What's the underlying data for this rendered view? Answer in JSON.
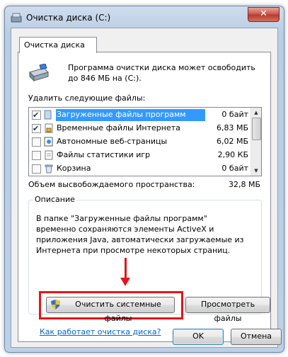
{
  "window": {
    "title": "Очистка диска  (C:)",
    "close_label": "✕"
  },
  "tab": {
    "label": "Очистка диска"
  },
  "intro_text": "Программа очистки диска может освободить до 846 МБ на  (C:).",
  "delete_label": "Удалить следующие файлы:",
  "files": [
    {
      "checked": true,
      "name": "Загруженные файлы программ",
      "size": "0 байт",
      "selected": true,
      "icon": "folder-icon"
    },
    {
      "checked": true,
      "name": "Временные файлы Интернета",
      "size": "6,83 МБ",
      "selected": false,
      "icon": "lock-file-icon"
    },
    {
      "checked": false,
      "name": "Автономные веб-страницы",
      "size": "6,02 МБ",
      "selected": false,
      "icon": "offline-page-icon"
    },
    {
      "checked": false,
      "name": "Файлы статистики игр",
      "size": "2,90 КБ",
      "selected": false,
      "icon": "page-icon"
    },
    {
      "checked": false,
      "name": "Корзина",
      "size": "0 байт",
      "selected": false,
      "icon": "recycle-bin-icon"
    }
  ],
  "total": {
    "label": "Объем высвобождаемого пространства:",
    "value": "32,8 МБ"
  },
  "description": {
    "title": "Описание",
    "text": "В папке \"Загруженные файлы программ\" временно сохраняются элементы ActiveX и приложения Java, автоматически загружаемые из Интернета при просмотре некоторых страниц."
  },
  "buttons": {
    "clean_system": "Очистить системные файлы",
    "view_files": "Просмотреть файлы",
    "ok": "OK",
    "cancel": "Отмена"
  },
  "help_link": "Как работает очистка диска?",
  "colors": {
    "highlight": "#e3151a",
    "selection": "#3399ff",
    "link": "#0066cc"
  }
}
